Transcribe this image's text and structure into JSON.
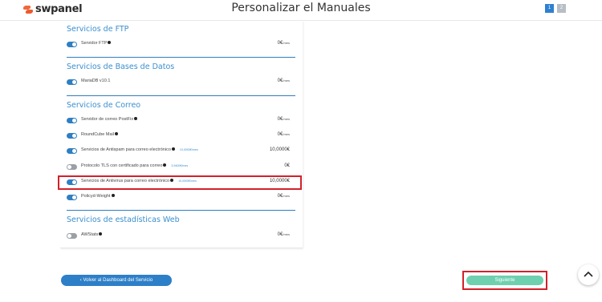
{
  "header": {
    "logo_text": "swpanel",
    "title": "Personalizar el Manuales",
    "steps": [
      "1",
      "2"
    ],
    "brand_color": "#f0683a"
  },
  "sections": [
    {
      "title": "Servicios de FTP",
      "items": [
        {
          "label": "Servidor FTP",
          "enabled": true,
          "info": true,
          "link": "",
          "price": "0€",
          "unit": "/mes"
        }
      ]
    },
    {
      "title": "Servicios de Bases de Datos",
      "items": [
        {
          "label": "MariaDB v10.1",
          "enabled": true,
          "info": false,
          "link": "",
          "price": "0€",
          "unit": "/mes"
        }
      ]
    },
    {
      "title": "Servicios de Correo",
      "items": [
        {
          "label": "Servidor de correo PostFix",
          "enabled": true,
          "info": true,
          "link": "",
          "price": "0€",
          "unit": "/mes"
        },
        {
          "label": "RoundCube Mail",
          "enabled": true,
          "info": true,
          "link": "",
          "price": "0€",
          "unit": "/mes"
        },
        {
          "label": "Servicios de Antispam para correo electrónico",
          "enabled": true,
          "info": true,
          "link": "10,0000€/mes",
          "price": "10,0000€",
          "unit": ""
        },
        {
          "label": "Protocolo TLS con certificado para correo",
          "enabled": false,
          "info": true,
          "link": "3,9400€/mes",
          "price": "0€",
          "unit": ""
        },
        {
          "label": "Servicios de Antivirus para correo electrónico",
          "enabled": true,
          "info": true,
          "link": "10,0000€/mes",
          "price": "10,0000€",
          "unit": ""
        },
        {
          "label": "Policyd-Weight",
          "enabled": true,
          "info": true,
          "link": "",
          "price": "0€",
          "unit": "/mes"
        }
      ]
    },
    {
      "title": "Servicios de estadísticas Web",
      "items": [
        {
          "label": "AWStats",
          "enabled": false,
          "info": true,
          "link": "",
          "price": "0€",
          "unit": "/mes"
        }
      ]
    }
  ],
  "footer": {
    "back_label": "‹  Volver al Dashboard del Servicio",
    "next_label": "Siguiente"
  },
  "colors": {
    "accent": "#2f7fc1",
    "next_button": "#6fd0b0",
    "highlight": "#d3212a"
  }
}
